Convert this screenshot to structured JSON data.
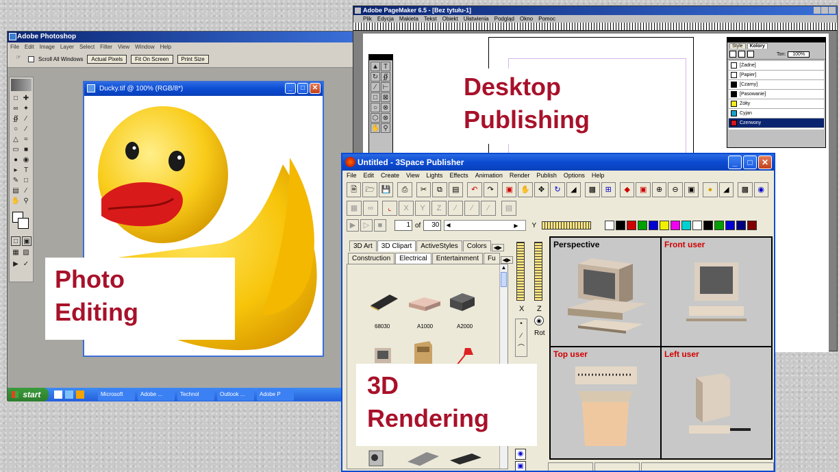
{
  "photoshop": {
    "title": "Adobe Photoshop",
    "menus": [
      "File",
      "Edit",
      "Image",
      "Layer",
      "Select",
      "Filter",
      "View",
      "Window",
      "Help"
    ],
    "options": {
      "scroll_all_label": "Scroll All Windows",
      "actual_pixels_label": "Actual Pixels",
      "fit_on_screen_label": "Fit On Screen",
      "print_size_label": "Print Size"
    },
    "document_title": "Ducky.tif @ 100% (RGB/8*)"
  },
  "taskbar": {
    "start_label": "start",
    "items": [
      "Microsoft",
      "Adobe ...",
      "Technol",
      "Outlook ...",
      "Adobe P"
    ]
  },
  "pagemaker": {
    "title": "Adobe PageMaker 6.5 - [Bez tytułu-1]",
    "menus": [
      "Plik",
      "Edycja",
      "Makieta",
      "Tekst",
      "Obiekt",
      "Ułatwienia",
      "Podgląd",
      "Okno",
      "Pomoc"
    ],
    "palette_tabs": [
      "Style",
      "Kolory"
    ],
    "tint_label": "Ton:",
    "tint_value": "100%",
    "colors": [
      {
        "name": "[Żadne]",
        "swatch": "#ffffff"
      },
      {
        "name": "[Papier]",
        "swatch": "#ffffff"
      },
      {
        "name": "[Czarny]",
        "swatch": "#000000"
      },
      {
        "name": "[Pasowanie]",
        "swatch": "#000000"
      },
      {
        "name": "Żółty",
        "swatch": "#f2ea1c"
      },
      {
        "name": "Cyjan",
        "swatch": "#1aa0c8"
      },
      {
        "name": "Czerwony",
        "swatch": "#d8121e"
      }
    ]
  },
  "space3d": {
    "title": "Untitled - 3Space Publisher",
    "menus": [
      "File",
      "Edit",
      "Create",
      "View",
      "Lights",
      "Effects",
      "Animation",
      "Render",
      "Publish",
      "Options",
      "Help"
    ],
    "frame_value": "1",
    "frame_of": "of",
    "frame_total": "30",
    "axis_y_label": "Y",
    "tabs_row1": [
      "3D Art",
      "3D Clipart",
      "ActiveStyles",
      "Colors"
    ],
    "tabs_row2": [
      "Construction",
      "Electrical",
      "Entertainment",
      "Fu"
    ],
    "clip_labels": [
      "68030",
      "A1000",
      "A2000"
    ],
    "side_labels": {
      "x": "X",
      "z": "Z",
      "rot": "Rot"
    },
    "views": [
      "Perspective",
      "Front user",
      "Top user",
      "Left user"
    ],
    "view_label_colors": [
      "#000000",
      "#d00000",
      "#d00000",
      "#d00000"
    ],
    "palette_colors": [
      "#ffffff",
      "#000000",
      "#d00000",
      "#00a000",
      "#0000d0",
      "#f0f000",
      "#f000f0",
      "#00d0d0",
      "#ffffff",
      "#000000",
      "#00a000",
      "#0000d0",
      "#000080",
      "#800000"
    ]
  },
  "captions": {
    "photo": [
      "Photo",
      "Editing"
    ],
    "desktop": [
      "Desktop",
      "Publishing"
    ],
    "rendering": [
      "3D",
      "Rendering"
    ]
  },
  "colors": {
    "caption_red": "#a8112a",
    "xp_blue": "#0b4bd2"
  }
}
